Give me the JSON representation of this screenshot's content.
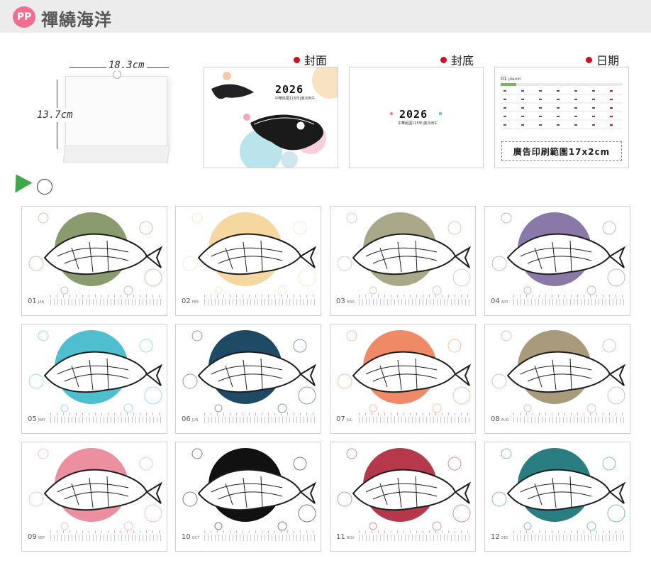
{
  "header": {
    "logo": "PP",
    "title": "禪繞海洋"
  },
  "product": {
    "width_label": "18.3cm",
    "height_label": "13.7cm"
  },
  "sections": {
    "cover": "封面",
    "back": "封底",
    "date": "日期"
  },
  "cover_year": "2026",
  "cover_subtitle": "中華民國115年|歲次丙午",
  "date_panel": {
    "month_label": "01",
    "month_name": "JANUARY",
    "print_area": "廣告印刷範圍17x2cm"
  },
  "months": [
    {
      "num": "01",
      "abbr": "JAN",
      "color": "#8a9b6e"
    },
    {
      "num": "02",
      "abbr": "FEB",
      "color": "#f6d7a0"
    },
    {
      "num": "03",
      "abbr": "MAR",
      "color": "#a9a98a"
    },
    {
      "num": "04",
      "abbr": "APR",
      "color": "#8a78a8"
    },
    {
      "num": "05",
      "abbr": "MAY",
      "color": "#4fbfcf"
    },
    {
      "num": "06",
      "abbr": "JUN",
      "color": "#1f4a66"
    },
    {
      "num": "07",
      "abbr": "JUL",
      "color": "#f08a66"
    },
    {
      "num": "08",
      "abbr": "AUG",
      "color": "#a89a7a"
    },
    {
      "num": "09",
      "abbr": "SEP",
      "color": "#ec8fa0"
    },
    {
      "num": "10",
      "abbr": "OCT",
      "color": "#111111"
    },
    {
      "num": "11",
      "abbr": "NOV",
      "color": "#b5394a"
    },
    {
      "num": "12",
      "abbr": "DEC",
      "color": "#2a7d80"
    }
  ],
  "colors": {
    "accent_red": "#d0101a",
    "logo_pink": "#ee6f8e"
  }
}
